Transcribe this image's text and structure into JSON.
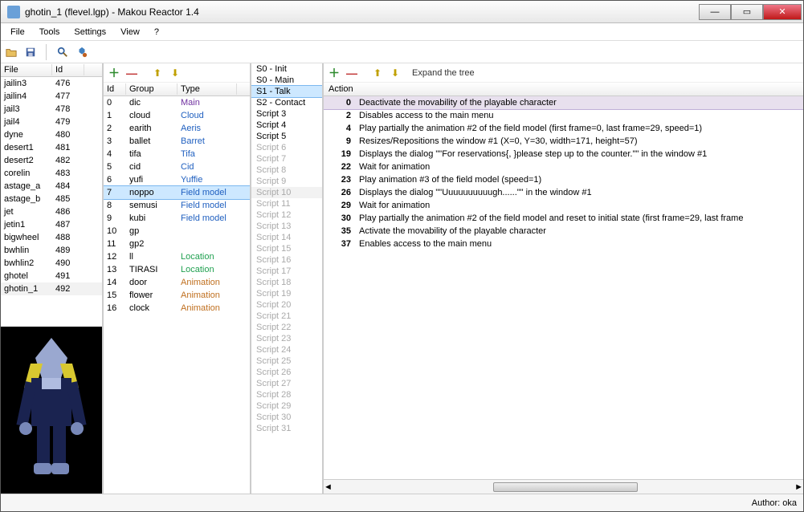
{
  "window": {
    "title": "ghotin_1 (flevel.lgp) - Makou Reactor 1.4",
    "min": "—",
    "max": "▭",
    "close": "✕"
  },
  "menu": [
    "File",
    "Tools",
    "Settings",
    "View",
    "?"
  ],
  "fileList": {
    "headers": [
      "File",
      "Id"
    ],
    "rows": [
      [
        "jailin3",
        "476"
      ],
      [
        "jailin4",
        "477"
      ],
      [
        "jail3",
        "478"
      ],
      [
        "jail4",
        "479"
      ],
      [
        "dyne",
        "480"
      ],
      [
        "desert1",
        "481"
      ],
      [
        "desert2",
        "482"
      ],
      [
        "corelin",
        "483"
      ],
      [
        "astage_a",
        "484"
      ],
      [
        "astage_b",
        "485"
      ],
      [
        "jet",
        "486"
      ],
      [
        "jetin1",
        "487"
      ],
      [
        "bigwheel",
        "488"
      ],
      [
        "bwhlin",
        "489"
      ],
      [
        "bwhlin2",
        "490"
      ],
      [
        "ghotel",
        "491"
      ],
      [
        "ghotin_1",
        "492"
      ]
    ],
    "selectedIndex": 16
  },
  "groupList": {
    "headers": [
      "Id",
      "Group",
      "Type"
    ],
    "rows": [
      {
        "id": "0",
        "group": "dic",
        "type": "Main",
        "cls": "c-main"
      },
      {
        "id": "1",
        "group": "cloud",
        "type": "Cloud",
        "cls": "c-char"
      },
      {
        "id": "2",
        "group": "earith",
        "type": "Aeris",
        "cls": "c-char"
      },
      {
        "id": "3",
        "group": "ballet",
        "type": "Barret",
        "cls": "c-char"
      },
      {
        "id": "4",
        "group": "tifa",
        "type": "Tifa",
        "cls": "c-char"
      },
      {
        "id": "5",
        "group": "cid",
        "type": "Cid",
        "cls": "c-char"
      },
      {
        "id": "6",
        "group": "yufi",
        "type": "Yuffie",
        "cls": "c-char"
      },
      {
        "id": "7",
        "group": "noppo",
        "type": "Field model",
        "cls": "c-char"
      },
      {
        "id": "8",
        "group": "semusi",
        "type": "Field model",
        "cls": "c-char"
      },
      {
        "id": "9",
        "group": "kubi",
        "type": "Field model",
        "cls": "c-char"
      },
      {
        "id": "10",
        "group": "gp",
        "type": "",
        "cls": ""
      },
      {
        "id": "11",
        "group": "gp2",
        "type": "",
        "cls": ""
      },
      {
        "id": "12",
        "group": "ll",
        "type": "Location",
        "cls": "c-loc"
      },
      {
        "id": "13",
        "group": "TIRASI",
        "type": "Location",
        "cls": "c-loc"
      },
      {
        "id": "14",
        "group": "door",
        "type": "Animation",
        "cls": "c-anim"
      },
      {
        "id": "15",
        "group": "flower",
        "type": "Animation",
        "cls": "c-anim"
      },
      {
        "id": "16",
        "group": "clock",
        "type": "Animation",
        "cls": "c-anim"
      }
    ],
    "selectedIndex": 7
  },
  "scriptList": {
    "items": [
      {
        "label": "S0 - Init",
        "on": true
      },
      {
        "label": "S0 - Main",
        "on": true
      },
      {
        "label": "S1 - Talk",
        "on": true,
        "selected": true
      },
      {
        "label": "S2 - Contact",
        "on": true
      },
      {
        "label": "Script 3",
        "on": true
      },
      {
        "label": "Script 4",
        "on": true
      },
      {
        "label": "Script 5",
        "on": true
      },
      {
        "label": "Script 6",
        "on": false
      },
      {
        "label": "Script 7",
        "on": false
      },
      {
        "label": "Script 8",
        "on": false
      },
      {
        "label": "Script 9",
        "on": false
      },
      {
        "label": "Script 10",
        "on": false,
        "sel2": true
      },
      {
        "label": "Script 11",
        "on": false
      },
      {
        "label": "Script 12",
        "on": false
      },
      {
        "label": "Script 13",
        "on": false
      },
      {
        "label": "Script 14",
        "on": false
      },
      {
        "label": "Script 15",
        "on": false
      },
      {
        "label": "Script 16",
        "on": false
      },
      {
        "label": "Script 17",
        "on": false
      },
      {
        "label": "Script 18",
        "on": false
      },
      {
        "label": "Script 19",
        "on": false
      },
      {
        "label": "Script 20",
        "on": false
      },
      {
        "label": "Script 21",
        "on": false
      },
      {
        "label": "Script 22",
        "on": false
      },
      {
        "label": "Script 23",
        "on": false
      },
      {
        "label": "Script 24",
        "on": false
      },
      {
        "label": "Script 25",
        "on": false
      },
      {
        "label": "Script 26",
        "on": false
      },
      {
        "label": "Script 27",
        "on": false
      },
      {
        "label": "Script 28",
        "on": false
      },
      {
        "label": "Script 29",
        "on": false
      },
      {
        "label": "Script 30",
        "on": false
      },
      {
        "label": "Script 31",
        "on": false
      }
    ]
  },
  "actionPanel": {
    "expandLabel": "Expand the tree",
    "header": "Action",
    "rows": [
      {
        "n": "0",
        "t": "Deactivate the movability of the playable character",
        "selected": true
      },
      {
        "n": "2",
        "t": "Disables access to the main menu"
      },
      {
        "n": "4",
        "t": "Play partially the animation #2 of the field model (first frame=0, last frame=29, speed=1)"
      },
      {
        "n": "9",
        "t": "Resizes/Repositions the window #1 (X=0, Y=30, width=171, height=57)"
      },
      {
        "n": "19",
        "t": "Displays the dialog \"\"For reservations{, }please step up to the counter.\"\" in the window #1"
      },
      {
        "n": "22",
        "t": "Wait for animation"
      },
      {
        "n": "23",
        "t": "Play animation #3 of the field model (speed=1)"
      },
      {
        "n": "26",
        "t": "Displays the dialog \"\"Uuuuuuuuuugh......\"\" in the window #1"
      },
      {
        "n": "29",
        "t": "Wait for animation"
      },
      {
        "n": "30",
        "t": "Play partially the animation #2 of the field model and reset to initial state (first frame=29, last frame"
      },
      {
        "n": "35",
        "t": "Activate the movability of the playable character"
      },
      {
        "n": "37",
        "t": "Enables access to the main menu"
      }
    ]
  },
  "status": {
    "author": "Author: oka"
  }
}
